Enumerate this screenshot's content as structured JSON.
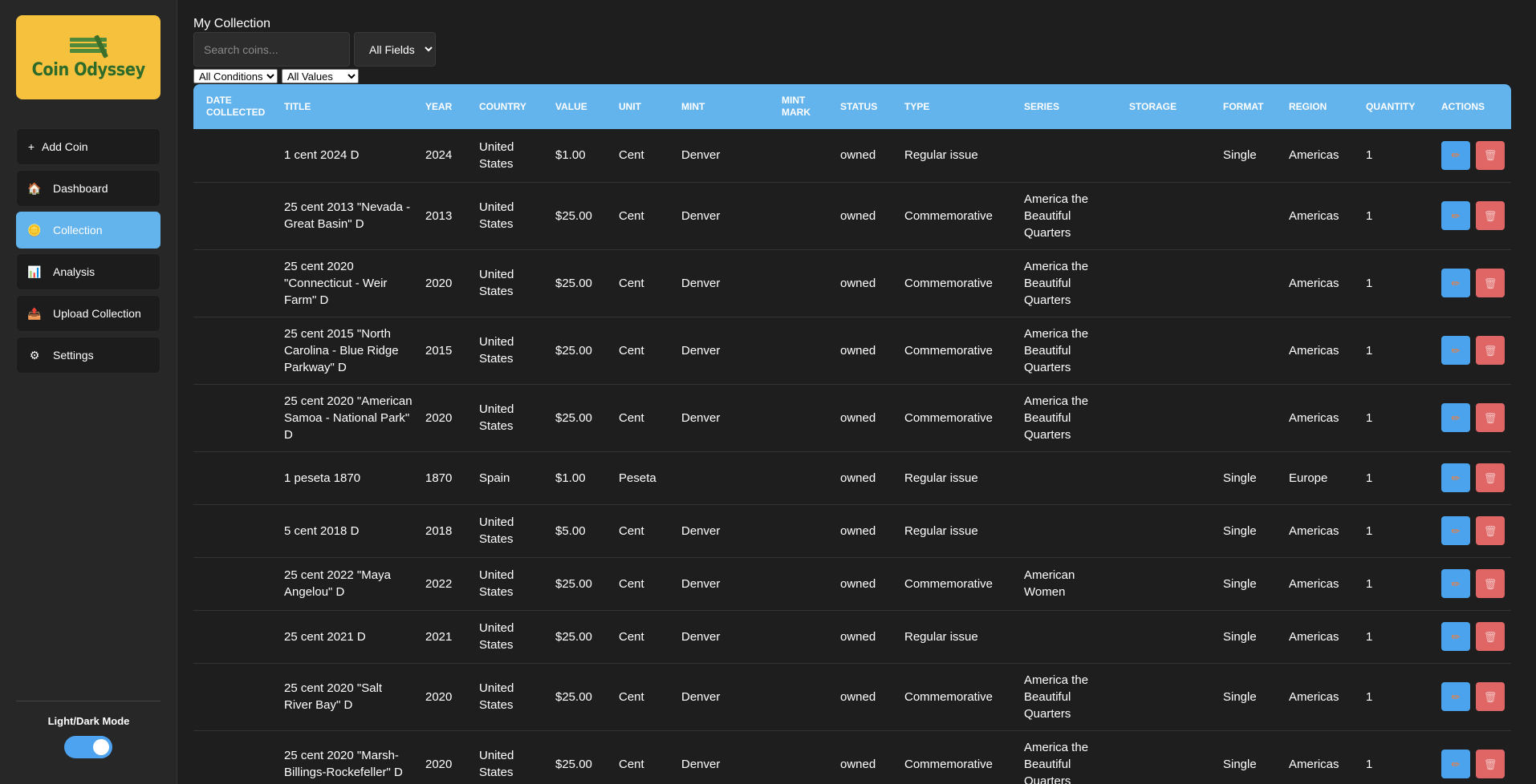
{
  "sidebar": {
    "logo_text": "Coin Odyssey",
    "items": [
      {
        "label": "Add Coin",
        "icon": "plus-icon",
        "glyph": "+",
        "active": false
      },
      {
        "label": "Dashboard",
        "icon": "home-icon",
        "glyph": "🏠",
        "active": false
      },
      {
        "label": "Collection",
        "icon": "coin-icon",
        "glyph": "🪙",
        "active": true
      },
      {
        "label": "Analysis",
        "icon": "chart-icon",
        "glyph": "📊",
        "active": false
      },
      {
        "label": "Upload Collection",
        "icon": "upload-icon",
        "glyph": "📤",
        "active": false
      },
      {
        "label": "Settings",
        "icon": "gear-icon",
        "glyph": "⚙",
        "active": false
      }
    ],
    "mode_label": "Light/Dark Mode"
  },
  "main": {
    "title": "My Collection",
    "search_placeholder": "Search coins...",
    "field_filter": "All Fields",
    "condition_filter": "All Conditions",
    "value_filter": "All Values"
  },
  "table": {
    "headers": [
      "Date Collected",
      "Title",
      "Year",
      "Country",
      "Value",
      "Unit",
      "Mint",
      "Mint Mark",
      "Status",
      "Type",
      "Series",
      "Storage",
      "Format",
      "Region",
      "Quantity",
      "Actions"
    ],
    "rows": [
      {
        "date": "",
        "title": "1 cent 2024 D",
        "year": "2024",
        "country": "United States",
        "value": "$1.00",
        "unit": "Cent",
        "mint": "Denver",
        "mint_mark": "",
        "status": "owned",
        "type": "Regular issue",
        "series": "",
        "storage": "",
        "format": "Single",
        "region": "Americas",
        "quantity": "1"
      },
      {
        "date": "",
        "title": "25 cent 2013 \"Nevada - Great Basin\" D",
        "year": "2013",
        "country": "United States",
        "value": "$25.00",
        "unit": "Cent",
        "mint": "Denver",
        "mint_mark": "",
        "status": "owned",
        "type": "Commemorative",
        "series": "America the Beautiful Quarters",
        "storage": "",
        "format": "",
        "region": "Americas",
        "quantity": "1"
      },
      {
        "date": "",
        "title": "25 cent 2020 \"Connecticut - Weir Farm\" D",
        "year": "2020",
        "country": "United States",
        "value": "$25.00",
        "unit": "Cent",
        "mint": "Denver",
        "mint_mark": "",
        "status": "owned",
        "type": "Commemorative",
        "series": "America the Beautiful Quarters",
        "storage": "",
        "format": "",
        "region": "Americas",
        "quantity": "1"
      },
      {
        "date": "",
        "title": "25 cent 2015 \"North Carolina - Blue Ridge Parkway\" D",
        "year": "2015",
        "country": "United States",
        "value": "$25.00",
        "unit": "Cent",
        "mint": "Denver",
        "mint_mark": "",
        "status": "owned",
        "type": "Commemorative",
        "series": "America the Beautiful Quarters",
        "storage": "",
        "format": "",
        "region": "Americas",
        "quantity": "1"
      },
      {
        "date": "",
        "title": "25 cent 2020 \"American Samoa - National Park\" D",
        "year": "2020",
        "country": "United States",
        "value": "$25.00",
        "unit": "Cent",
        "mint": "Denver",
        "mint_mark": "",
        "status": "owned",
        "type": "Commemorative",
        "series": "America the Beautiful Quarters",
        "storage": "",
        "format": "",
        "region": "Americas",
        "quantity": "1"
      },
      {
        "date": "",
        "title": "1 peseta 1870",
        "year": "1870",
        "country": "Spain",
        "value": "$1.00",
        "unit": "Peseta",
        "mint": "",
        "mint_mark": "",
        "status": "owned",
        "type": "Regular issue",
        "series": "",
        "storage": "",
        "format": "Single",
        "region": "Europe",
        "quantity": "1"
      },
      {
        "date": "",
        "title": "5 cent 2018 D",
        "year": "2018",
        "country": "United States",
        "value": "$5.00",
        "unit": "Cent",
        "mint": "Denver",
        "mint_mark": "",
        "status": "owned",
        "type": "Regular issue",
        "series": "",
        "storage": "",
        "format": "Single",
        "region": "Americas",
        "quantity": "1"
      },
      {
        "date": "",
        "title": "25 cent 2022 \"Maya Angelou\" D",
        "year": "2022",
        "country": "United States",
        "value": "$25.00",
        "unit": "Cent",
        "mint": "Denver",
        "mint_mark": "",
        "status": "owned",
        "type": "Commemorative",
        "series": "American Women",
        "storage": "",
        "format": "Single",
        "region": "Americas",
        "quantity": "1"
      },
      {
        "date": "",
        "title": "25 cent 2021 D",
        "year": "2021",
        "country": "United States",
        "value": "$25.00",
        "unit": "Cent",
        "mint": "Denver",
        "mint_mark": "",
        "status": "owned",
        "type": "Regular issue",
        "series": "",
        "storage": "",
        "format": "Single",
        "region": "Americas",
        "quantity": "1"
      },
      {
        "date": "",
        "title": "25 cent 2020 \"Salt River Bay\" D",
        "year": "2020",
        "country": "United States",
        "value": "$25.00",
        "unit": "Cent",
        "mint": "Denver",
        "mint_mark": "",
        "status": "owned",
        "type": "Commemorative",
        "series": "America the Beautiful Quarters",
        "storage": "",
        "format": "Single",
        "region": "Americas",
        "quantity": "1"
      },
      {
        "date": "",
        "title": "25 cent 2020 \"Marsh-Billings-Rockefeller\" D",
        "year": "2020",
        "country": "United States",
        "value": "$25.00",
        "unit": "Cent",
        "mint": "Denver",
        "mint_mark": "",
        "status": "owned",
        "type": "Commemorative",
        "series": "America the Beautiful Quarters",
        "storage": "",
        "format": "Single",
        "region": "Americas",
        "quantity": "1"
      }
    ],
    "edit_icon": "pencil-icon",
    "delete_icon": "trash-icon",
    "edit_glyph": "✏",
    "delete_glyph": "🗑"
  },
  "colors": {
    "accent": "#63b3ed",
    "logo_bg": "#f6c23e",
    "delete": "#e06666",
    "background": "#1e1e1e"
  }
}
